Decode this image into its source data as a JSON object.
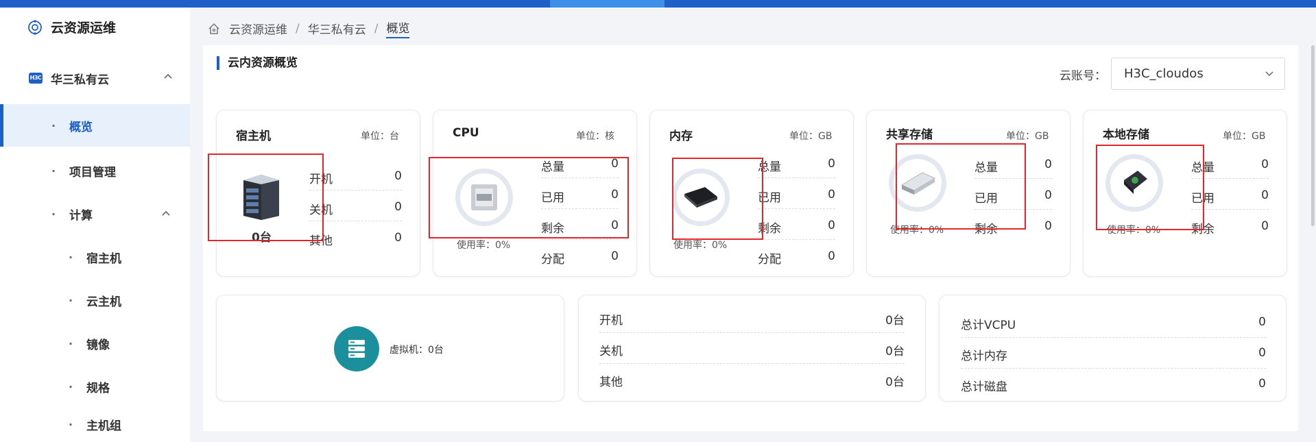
{
  "app": {
    "title": "云资源运维"
  },
  "sidebar": {
    "group": {
      "label": "华三私有云",
      "badge": "H3C"
    },
    "items": [
      {
        "label": "概览"
      },
      {
        "label": "项目管理"
      },
      {
        "label": "计算"
      },
      {
        "label": "宿主机"
      },
      {
        "label": "云主机"
      },
      {
        "label": "镜像"
      },
      {
        "label": "规格"
      },
      {
        "label": "主机组"
      }
    ]
  },
  "breadcrumb": {
    "items": [
      "云资源运维",
      "华三私有云",
      "概览"
    ]
  },
  "panel": {
    "title": "云内资源概览"
  },
  "account": {
    "label": "云账号：",
    "value": "H3C_cloudos"
  },
  "cards": {
    "host": {
      "title": "宿主机",
      "unit": "单位：台",
      "count": "0台",
      "rows": [
        {
          "label": "开机",
          "value": "0"
        },
        {
          "label": "关机",
          "value": "0"
        },
        {
          "label": "其他",
          "value": "0"
        }
      ]
    },
    "cpu": {
      "title": "CPU",
      "unit": "单位：核",
      "usage": "使用率：0%",
      "rows": [
        {
          "label": "总量",
          "value": "0"
        },
        {
          "label": "已用",
          "value": "0"
        },
        {
          "label": "剩余",
          "value": "0"
        },
        {
          "label": "分配",
          "value": "0"
        }
      ]
    },
    "memory": {
      "title": "内存",
      "unit": "单位：GB",
      "usage": "使用率：0%",
      "rows": [
        {
          "label": "总量",
          "value": "0"
        },
        {
          "label": "已用",
          "value": "0"
        },
        {
          "label": "剩余",
          "value": "0"
        },
        {
          "label": "分配",
          "value": "0"
        }
      ]
    },
    "shared": {
      "title": "共享存储",
      "unit": "单位：GB",
      "usage": "使用率：0%",
      "rows": [
        {
          "label": "总量",
          "value": "0"
        },
        {
          "label": "已用",
          "value": "0"
        },
        {
          "label": "剩余",
          "value": "0"
        }
      ]
    },
    "local": {
      "title": "本地存储",
      "unit": "单位：GB",
      "usage": "使用率：0%",
      "rows": [
        {
          "label": "总量",
          "value": "0"
        },
        {
          "label": "已用",
          "value": "0"
        },
        {
          "label": "剩余",
          "value": "0"
        }
      ]
    }
  },
  "vm": {
    "label": "虚拟机：0台",
    "status": [
      {
        "label": "开机",
        "value": "0台"
      },
      {
        "label": "关机",
        "value": "0台"
      },
      {
        "label": "其他",
        "value": "0台"
      }
    ],
    "totals": [
      {
        "label": "总计VCPU",
        "value": "0"
      },
      {
        "label": "总计内存",
        "value": "0"
      },
      {
        "label": "总计磁盘",
        "value": "0"
      }
    ]
  },
  "colors": {
    "accent": "#1f5fc8",
    "vm_icon": "#1b8f9c",
    "highlight": "#e3262b"
  }
}
